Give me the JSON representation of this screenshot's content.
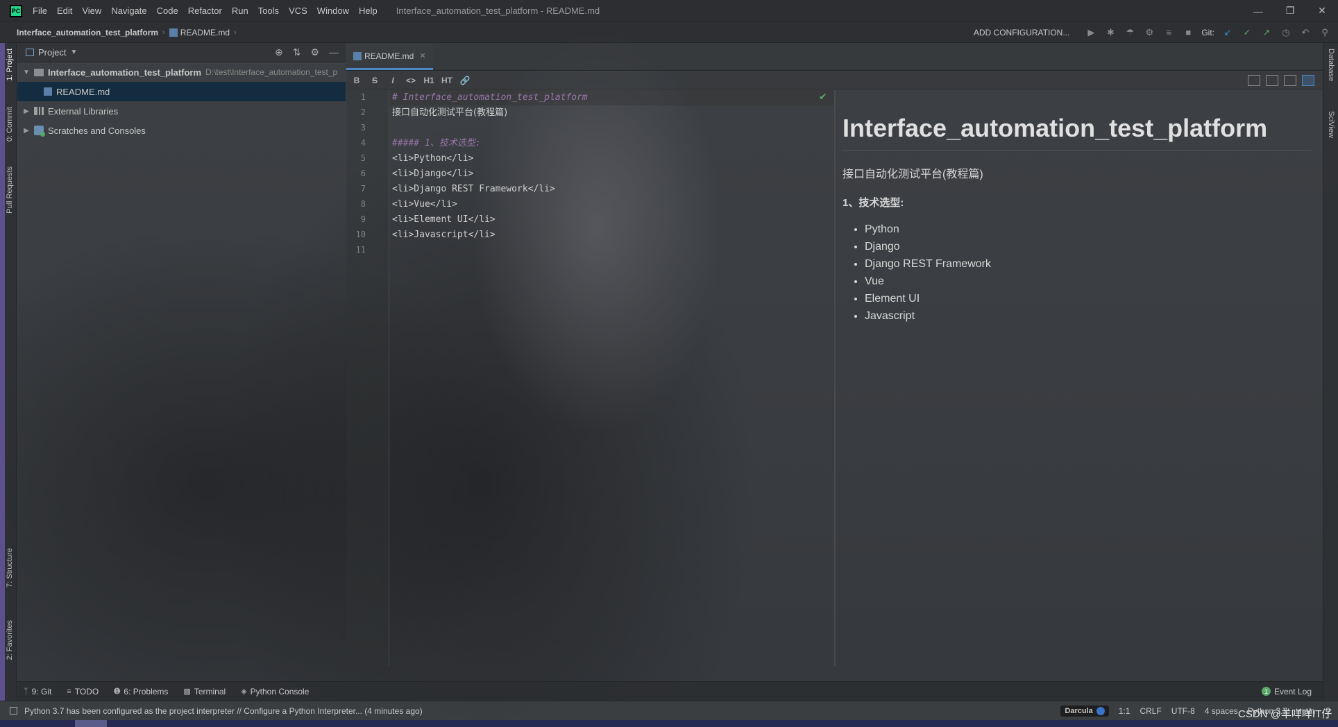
{
  "window": {
    "title": "Interface_automation_test_platform - README.md",
    "app_logo": "PC",
    "controls": [
      "minimize-icon",
      "restore-icon",
      "close-icon"
    ]
  },
  "menu": [
    "File",
    "Edit",
    "View",
    "Navigate",
    "Code",
    "Refactor",
    "Run",
    "Tools",
    "VCS",
    "Window",
    "Help"
  ],
  "breadcrumb": {
    "project": "Interface_automation_test_platform",
    "file": "README.md"
  },
  "toolbar": {
    "add_config": "ADD CONFIGURATION...",
    "git_label": "Git:"
  },
  "left_tabs": {
    "project": "1: Project",
    "commit": "0: Commit",
    "pull_requests": "Pull Requests",
    "structure": "7: Structure",
    "favorites": "2: Favorites"
  },
  "right_tabs": {
    "database": "Database",
    "sciview": "SciView"
  },
  "project_panel": {
    "title": "Project",
    "root": "Interface_automation_test_platform",
    "root_path": "D:\\test\\Interface_automation_test_p",
    "readme": "README.md",
    "external_libraries": "External Libraries",
    "scratches": "Scratches and Consoles"
  },
  "editor": {
    "tab_label": "README.md",
    "md_buttons": [
      "B",
      "S",
      "I",
      "<>",
      "H1",
      "HT",
      "link"
    ],
    "line_numbers": [
      "1",
      "2",
      "3",
      "4",
      "5",
      "6",
      "7",
      "8",
      "9",
      "10",
      "11"
    ],
    "lines": [
      "# Interface_automation_test_platform",
      "接口自动化测试平台(教程篇)",
      "",
      "##### 1、技术选型:",
      "<li>Python</li>",
      "<li>Django</li>",
      "<li>Django REST Framework</li>",
      "<li>Vue</li>",
      "<li>Element UI</li>",
      "<li>Javascript</li>",
      ""
    ]
  },
  "preview": {
    "h1": "Interface_automation_test_platform",
    "p": "接口自动化测试平台(教程篇)",
    "h5": "1、技术选型:",
    "items": [
      "Python",
      "Django",
      "Django REST Framework",
      "Vue",
      "Element UI",
      "Javascript"
    ]
  },
  "tool_tabs": {
    "git": "9: Git",
    "todo": "TODO",
    "problems": "6: Problems",
    "terminal": "Terminal",
    "python_console": "Python Console",
    "event_log": "Event Log",
    "event_count": "1"
  },
  "status": {
    "message": "Python 3.7 has been configured as the project interpreter // Configure a Python Interpreter... (4 minutes ago)",
    "theme": "Darcula",
    "position": "1:1",
    "line_sep": "CRLF",
    "encoding": "UTF-8",
    "indent": "4 spaces",
    "interpreter": "Python 3.7",
    "branch": "main"
  },
  "watermark": "CSDN @羊咩咩IT仔",
  "colors": {
    "accent": "#4a88c7",
    "heading": "#9876aa",
    "ok": "#59a869",
    "selection": "#0d293e"
  }
}
